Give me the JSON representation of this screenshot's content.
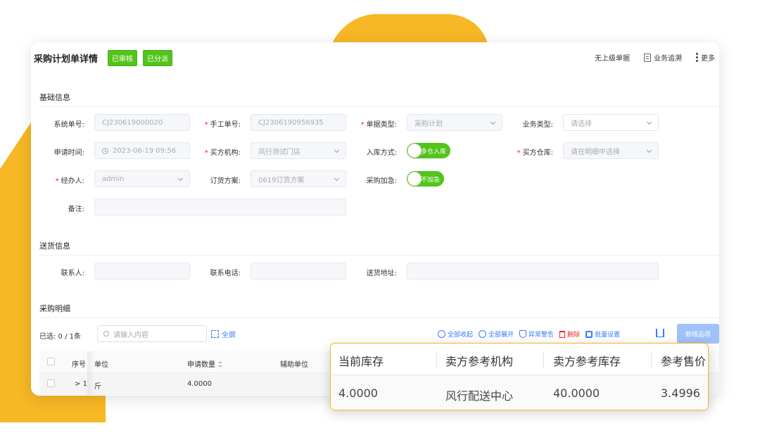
{
  "header": {
    "title": "采购计划单详情",
    "badges": [
      "已审核",
      "已分派"
    ],
    "actions": {
      "no_parent": "无上级单据",
      "trace": "业务追溯",
      "more": "更多"
    }
  },
  "basic_info": {
    "section_title": "基础信息",
    "system_no": {
      "label": "系统单号:",
      "value": "CJ230619000020"
    },
    "manual_no": {
      "label": "手工单号:",
      "value": "CJ2306190956935",
      "required": "*"
    },
    "doc_type": {
      "label": "单据类型:",
      "value": "采购计划",
      "required": "*"
    },
    "biz_type": {
      "label": "业务类型:",
      "placeholder": "请选择"
    },
    "apply_time": {
      "label": "申请时间:",
      "value": "2023-06-19 09:56"
    },
    "buyer_org": {
      "label": "买方机构:",
      "value": "风行测试门店",
      "required": "*"
    },
    "inbound_mode": {
      "label": "入库方式:",
      "value": "多仓入库"
    },
    "buyer_warehouse": {
      "label": "买方仓库:",
      "placeholder": "请在明细中选择",
      "required": "*"
    },
    "handler": {
      "label": "经办人:",
      "value": "admin",
      "required": "*"
    },
    "order_plan": {
      "label": "订货方案:",
      "value": "0619订货方案"
    },
    "urgent": {
      "label": "采购加急:",
      "value": "不加急"
    },
    "remark": {
      "label": "备注:",
      "value": ""
    }
  },
  "delivery_info": {
    "section_title": "送货信息",
    "contact": {
      "label": "联系人:",
      "value": ""
    },
    "phone": {
      "label": "联系电话:",
      "value": ""
    },
    "address": {
      "label": "送货地址:",
      "value": ""
    }
  },
  "detail": {
    "section_title": "采购明细",
    "selected": "已选: 0 / 1条",
    "search_placeholder": "请输入内容",
    "fullscreen": "全屏",
    "actions": {
      "collapse_all": "全部收起",
      "expand_all": "全部展开",
      "warning": "异常警告",
      "delete": "删除",
      "batch": "批量设置"
    },
    "add_item": "新增品项",
    "columns": [
      "序号",
      "单位",
      "申请数量",
      "辅助单位"
    ],
    "rows": [
      {
        "index": "1",
        "index_prefix": ">",
        "unit": "斤",
        "qty": "4.0000"
      }
    ]
  },
  "popup": {
    "columns": [
      "当前库存",
      "卖方参考机构",
      "卖方参考库存",
      "参考售价"
    ],
    "values": [
      "4.0000",
      "风行配送中心",
      "40.0000",
      "3.4996"
    ]
  },
  "colors": {
    "accent_yellow": "#f7b825",
    "badge_green": "#52c41a",
    "link_blue": "#3a7bf7",
    "danger_red": "#f5222d"
  }
}
